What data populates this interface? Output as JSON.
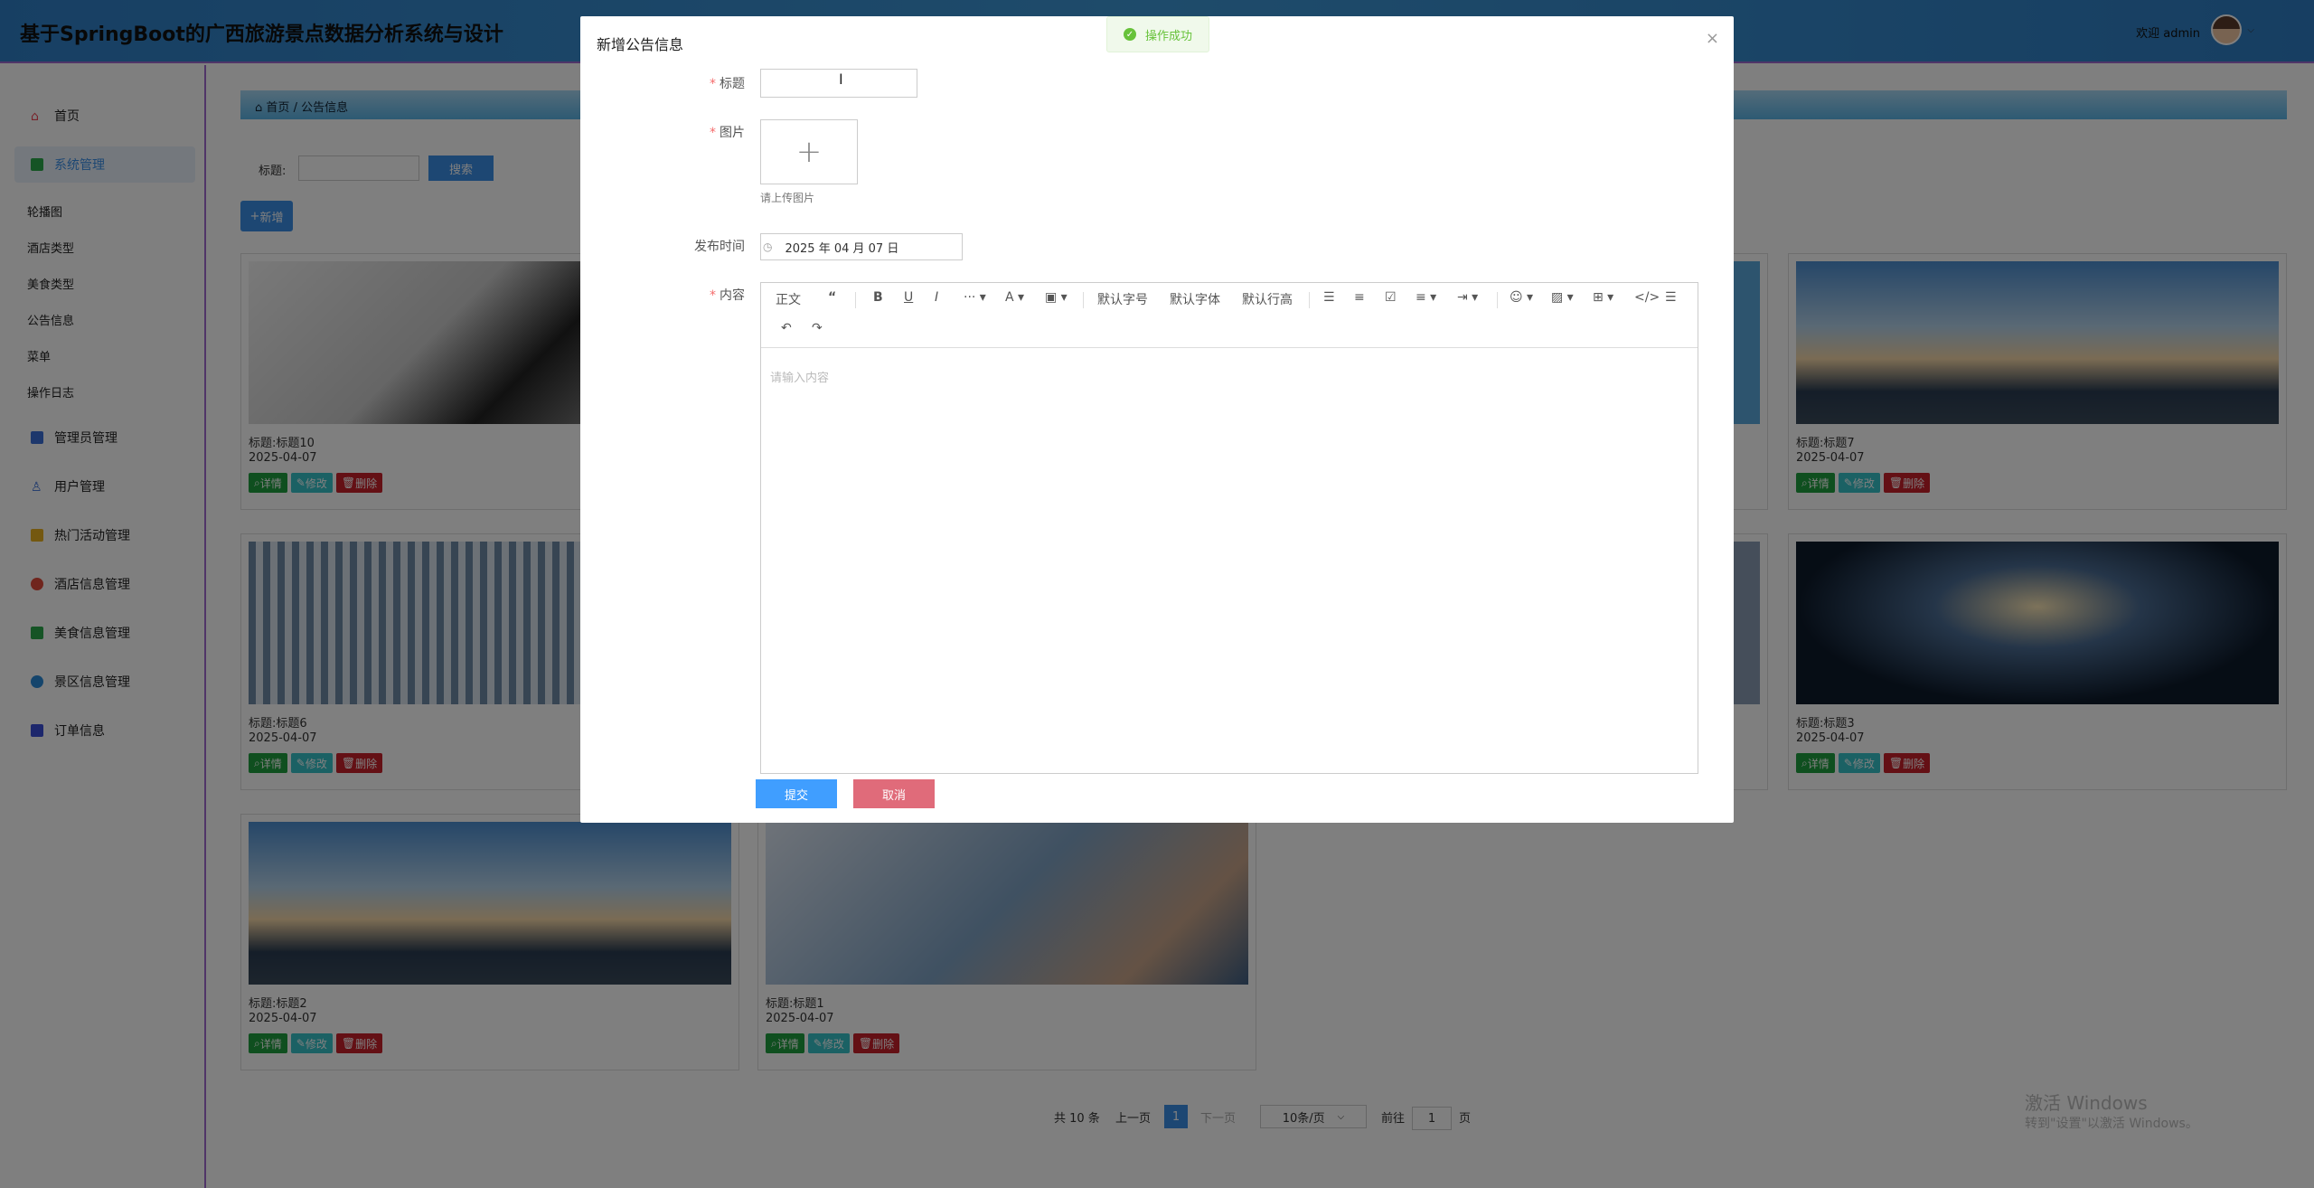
{
  "header": {
    "title": "基于SpringBoot的广西旅游景点数据分析系统与设计",
    "welcome": "欢迎 admin"
  },
  "sidebar": {
    "items": [
      {
        "label": "首页"
      },
      {
        "label": "系统管理"
      },
      {
        "label": "管理员管理"
      },
      {
        "label": "用户管理"
      },
      {
        "label": "热门活动管理"
      },
      {
        "label": "酒店信息管理"
      },
      {
        "label": "美食信息管理"
      },
      {
        "label": "景区信息管理"
      },
      {
        "label": "订单信息"
      }
    ],
    "sub_items": [
      "轮播图",
      "酒店类型",
      "美食类型",
      "公告信息",
      "菜单",
      "操作日志"
    ]
  },
  "breadcrumb": {
    "home": "首页",
    "current": "公告信息"
  },
  "search": {
    "label": "标题:",
    "button": "搜索"
  },
  "add_button": "新增",
  "cards": [
    {
      "title": "标题:标题10",
      "date": "2025-04-07"
    },
    {
      "title": "标题:标题7",
      "date": "2025-04-07"
    },
    {
      "title": "标题:标题6",
      "date": "2025-04-07"
    },
    {
      "title": "标题:标题3",
      "date": "2025-04-07"
    },
    {
      "title": "标题:标题2",
      "date": "2025-04-07"
    },
    {
      "title": "标题:标题1",
      "date": "2025-04-07"
    }
  ],
  "card_buttons": {
    "detail": "详情",
    "edit": "修改",
    "delete": "删除"
  },
  "pagination": {
    "total": "共 10 条",
    "prev": "上一页",
    "current": "1",
    "next": "下一页",
    "page_size": "10条/页",
    "goto": "前往",
    "goto_value": "1",
    "unit": "页"
  },
  "watermark": {
    "line1": "激活 Windows",
    "line2": "转到\"设置\"以激活 Windows。"
  },
  "modal": {
    "title": "新增公告信息",
    "close": "×",
    "fields": {
      "title_label": "标题",
      "image_label": "图片",
      "upload_hint": "请上传图片",
      "date_label": "发布时间",
      "date_value": "2025 年 04 月 07 日",
      "content_label": "内容"
    },
    "toolbar": {
      "paragraph": "正文",
      "font_size": "默认字号",
      "font_family": "默认字体",
      "line_height": "默认行高"
    },
    "editor_placeholder": "请输入内容",
    "submit": "提交",
    "cancel": "取消"
  },
  "toast": {
    "message": "操作成功",
    "color": "#67c23a"
  },
  "colors": {
    "primary": "#3a8ee6",
    "danger": "#c8202a",
    "success": "#1e9e3e",
    "info": "#36c3c9"
  }
}
